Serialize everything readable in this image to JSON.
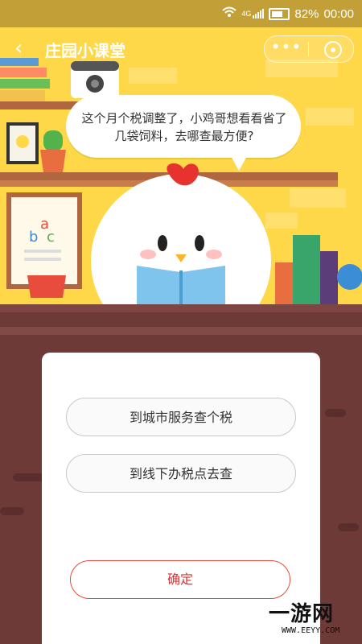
{
  "status_bar": {
    "network": "4G",
    "battery": "82%",
    "time": "00:00"
  },
  "nav": {
    "back_icon": "chevron-left-icon",
    "title": "庄园小课堂",
    "more_icon": "more-icon",
    "close_icon": "close-mini-program-icon"
  },
  "scene": {
    "bubble_text": "这个月个税调整了，小鸡哥想看看省了几袋饲料，去哪查最方便?",
    "card_letters": "a b c"
  },
  "quiz": {
    "options": [
      {
        "label": "到城市服务查个税"
      },
      {
        "label": "到线下办税点去查"
      }
    ],
    "confirm_label": "确定"
  },
  "watermark": {
    "brand": "一游网",
    "url": "WWW.EEYY.COM"
  },
  "colors": {
    "header_gold": "#c2a037",
    "scene_yellow": "#ffd84a",
    "floor_brown": "#6e3a38",
    "confirm_red": "#e74a3b"
  }
}
